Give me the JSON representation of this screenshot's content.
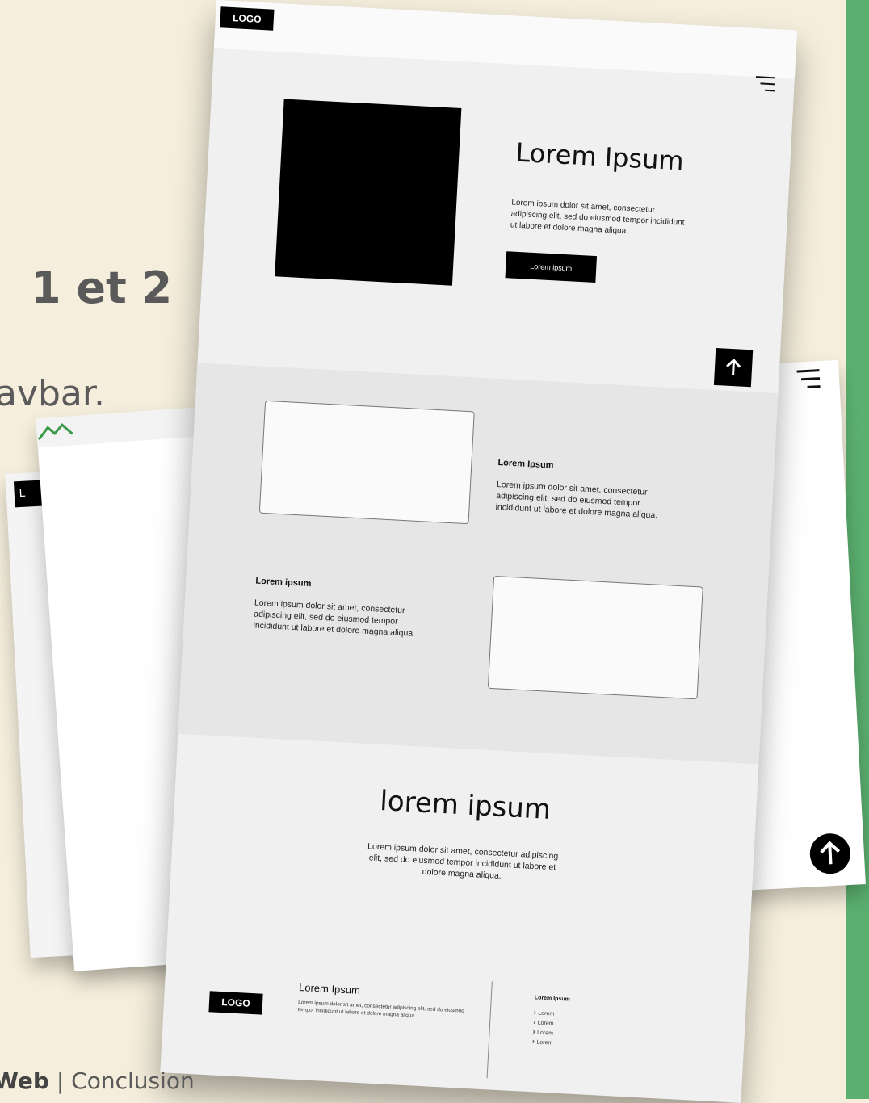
{
  "slide": {
    "heading_fragment": "1 et 2",
    "subtext_fragment": "avbar.",
    "footer_bold": "Web",
    "footer_sep": " | ",
    "footer_rest": "Conclusion"
  },
  "left_mock": {
    "logo_letter": "L"
  },
  "mockup": {
    "logo": "LOGO",
    "hero": {
      "title": "Lorem Ipsum",
      "text": "Lorem ipsum dolor sit amet, consectetur adipiscing elit, sed do eiusmod tempor incididunt ut labore et dolore magna aliqua.",
      "button": "Lorem ipsum"
    },
    "feature1": {
      "title": "Lorem Ipsum",
      "text": "Lorem ipsum dolor sit amet, consectetur adipiscing elit, sed do eiusmod tempor incididunt ut labore et dolore magna aliqua."
    },
    "feature2": {
      "title": "Lorem ipsum",
      "text": "Lorem ipsum dolor sit amet, consectetur adipiscing elit, sed do eiusmod tempor incididunt ut labore et dolore magna aliqua."
    },
    "section3": {
      "title": "lorem ipsum",
      "text": "Lorem ipsum dolor sit amet, consectetur adipiscing elit, sed do eiusmod tempor incididunt ut labore et dolore magna aliqua."
    },
    "footer": {
      "logo": "LOGO",
      "title": "Lorem Ipsum",
      "text": "Lorem ipsum dolor sit amet, consectetur adipiscing elit, sed do eiusmod tempor incididunt ut labore et dolore magna aliqua.",
      "list_title": "Lorem Ipsum",
      "list": [
        "Lorem",
        "Lorem",
        "Lorem",
        "Lorem"
      ]
    }
  },
  "colors": {
    "background": "#f5eedc",
    "accent_bar": "#5bb06f",
    "text": "#5a5a5a"
  }
}
